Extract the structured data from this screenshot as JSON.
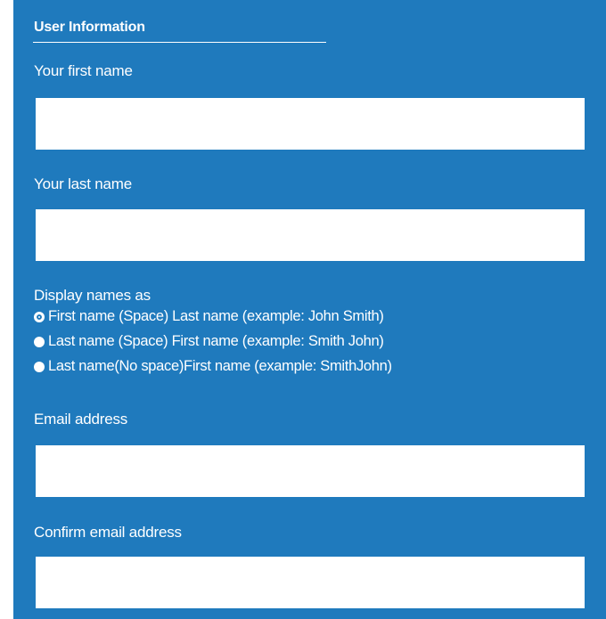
{
  "form": {
    "section_title": "User Information",
    "first_name": {
      "label": "Your first name",
      "value": ""
    },
    "last_name": {
      "label": "Your last name",
      "value": ""
    },
    "display_names": {
      "label": "Display names as",
      "options": [
        {
          "label": "First name (Space) Last name (example: John Smith)",
          "selected": true
        },
        {
          "label": "Last name (Space) First name (example: Smith John)",
          "selected": false
        },
        {
          "label": "Last name(No space)First name (example: SmithJohn)",
          "selected": false
        }
      ]
    },
    "email": {
      "label": "Email address",
      "value": ""
    },
    "confirm_email": {
      "label": "Confirm email address",
      "value": ""
    }
  },
  "colors": {
    "panel_background": "#1f7abd",
    "text": "#ffffff",
    "input_background": "#ffffff"
  }
}
